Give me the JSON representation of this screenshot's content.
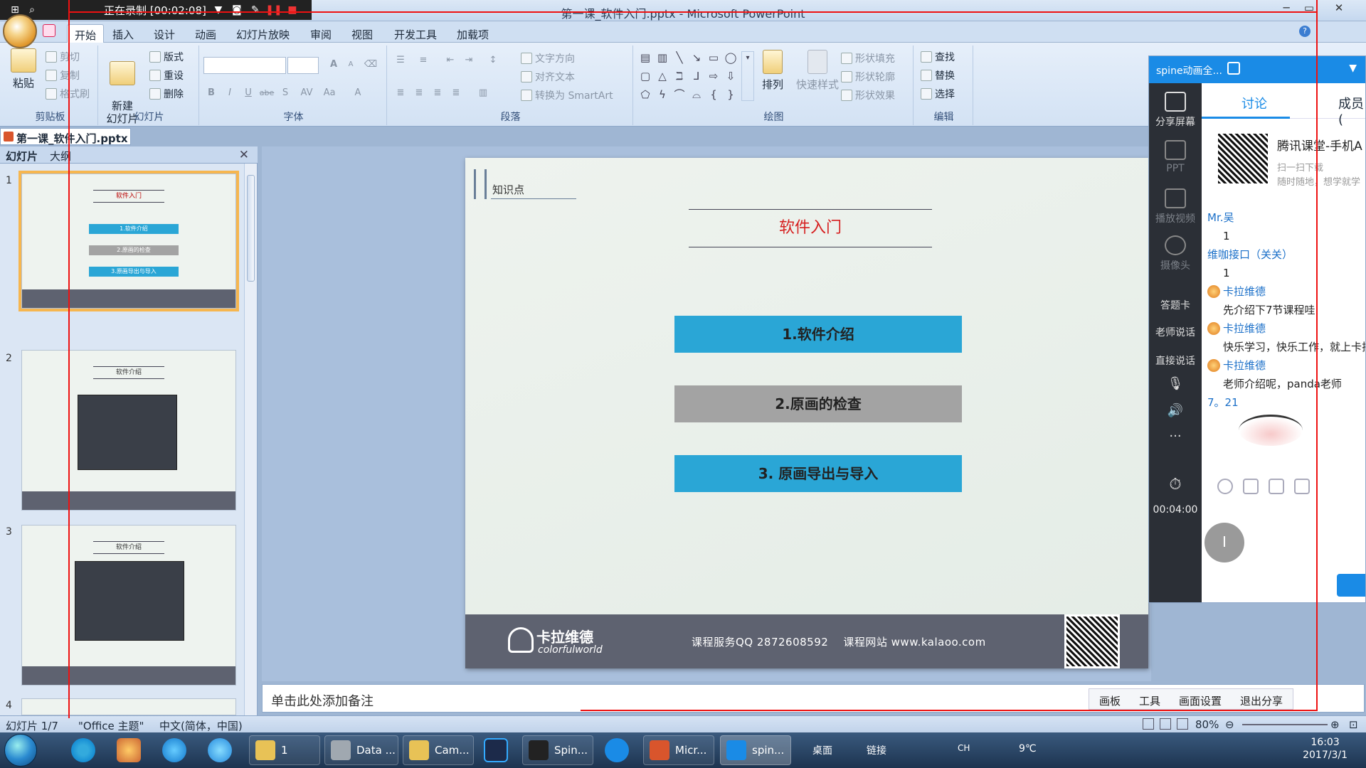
{
  "recording": {
    "status_text": "正在录制 [00:02:08]"
  },
  "window": {
    "title": "第一课_软件入门.pptx - Microsoft PowerPoint"
  },
  "ribbon_tabs": [
    "开始",
    "插入",
    "设计",
    "动画",
    "幻灯片放映",
    "审阅",
    "视图",
    "开发工具",
    "加载项"
  ],
  "ribbon": {
    "clipboard": {
      "paste": "粘贴",
      "cut": "剪切",
      "copy": "复制",
      "format_painter": "格式刷",
      "label": "剪贴板"
    },
    "slides": {
      "new_slide": "新建\n幻灯片",
      "layout": "版式",
      "reset": "重设",
      "delete": "删除",
      "label": "幻灯片"
    },
    "font": {
      "label": "字体",
      "bold": "B",
      "italic": "I",
      "underline": "U",
      "strike": "abe",
      "shadow": "S",
      "spacing": "AV",
      "case": "Aa",
      "color": "A",
      "grow": "A",
      "shrink": "A"
    },
    "paragraph": {
      "text_direction": "文字方向",
      "align_text": "对齐文本",
      "smartart": "转换为 SmartArt",
      "label": "段落"
    },
    "drawing": {
      "arrange": "排列",
      "quick_styles": "快速样式",
      "fill": "形状填充",
      "outline": "形状轮廓",
      "effects": "形状效果",
      "label": "绘图"
    },
    "editing": {
      "find": "查找",
      "replace": "替换",
      "select": "选择",
      "label": "编辑"
    }
  },
  "document_tab": "第一课_软件入门.pptx",
  "pane": {
    "tab_slides": "幻灯片",
    "tab_outline": "大纲"
  },
  "thumbnails": [
    {
      "num": "1",
      "title": "软件入门",
      "items": [
        "1.软件介绍",
        "2.原画的检查",
        "3.原画导出与导入"
      ]
    },
    {
      "num": "2",
      "title": "软件介绍"
    },
    {
      "num": "3",
      "title": "软件介绍"
    },
    {
      "num": "4"
    }
  ],
  "slide": {
    "section_label": "知识点",
    "title": "软件入门",
    "items": [
      "1.软件介绍",
      "2.原画的检查",
      "3. 原画导出与导入"
    ],
    "item_colors": [
      "#2aa6d6",
      "#a3a3a3",
      "#2aa6d6"
    ],
    "footer_logo": "卡拉维德",
    "footer_logo_sub": "colorfulworld",
    "footer_info": "课程服务QQ 2872608592    课程网站 www.kalaoo.com"
  },
  "notes": {
    "placeholder": "单击此处添加备注"
  },
  "notes_tools": [
    "画板",
    "工具",
    "画面设置",
    "退出分享"
  ],
  "status": {
    "slide_info": "幻灯片 1/7",
    "theme": "\"Office 主题\"",
    "language": "中文(简体，中国)",
    "zoom": "80%"
  },
  "taskbar": {
    "items": [
      {
        "label": "1",
        "color": "#e8c256"
      },
      {
        "label": "Data ...",
        "color": "#a0a8b0"
      },
      {
        "label": "Cam...",
        "color": "#e8c256"
      },
      {
        "label": "Spin...",
        "color": "#222"
      },
      {
        "label": "Micr...",
        "color": "#d9552c"
      },
      {
        "label": "spin...",
        "color": "#1a8be6"
      }
    ],
    "desktop": "桌面",
    "links": "链接",
    "ime": "CH",
    "weather": "9℃",
    "time": "16:03",
    "date": "2017/3/1"
  },
  "tencent": {
    "header_name": "spine动画全...",
    "sidebar": [
      "分享屏幕",
      "PPT",
      "播放视频",
      "摄像头",
      "答题卡",
      "老师说话",
      "直接说话"
    ],
    "timer": "00:04:00",
    "tab_discuss": "讨论",
    "tab_members": "成员(",
    "ad_title": "腾讯课堂-手机A",
    "ad_sub1": "扫一扫下载",
    "ad_sub2": "随时随地，想学就学",
    "messages": [
      {
        "name": "Mr.吴",
        "text": "1",
        "avatar": false
      },
      {
        "name": "维咖接口（关关）",
        "text": "1",
        "avatar": false
      },
      {
        "name": "卡拉维德",
        "text": "先介绍下7节课程哇",
        "avatar": true
      },
      {
        "name": "卡拉维德",
        "text": "快乐学习，快乐工作，就上卡拉",
        "avatar": true
      },
      {
        "name": "卡拉维德",
        "text": "老师介绍呢，panda老师",
        "avatar": true
      },
      {
        "name": "7。21",
        "text": "",
        "avatar": false
      }
    ],
    "cursor_char": "I"
  }
}
